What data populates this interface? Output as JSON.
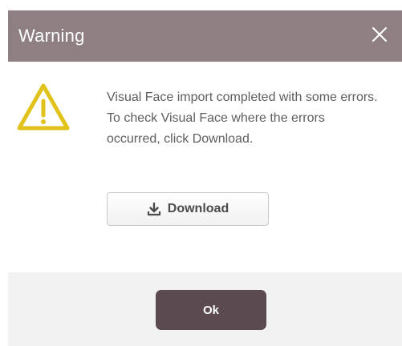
{
  "dialog": {
    "title": "Warning",
    "close_icon": "close-icon",
    "warning_icon": "warning-triangle-icon",
    "message": "Visual Face import completed with some errors. To check Visual Face where the errors occurred, click Download.",
    "download_button": {
      "label": "Download",
      "icon": "download-icon"
    },
    "ok_button": {
      "label": "Ok"
    }
  },
  "colors": {
    "titlebar": "#8e7f83",
    "warning_icon": "#e0c21b",
    "ok_button": "#5b4a4f",
    "footer": "#f2f2f2"
  }
}
